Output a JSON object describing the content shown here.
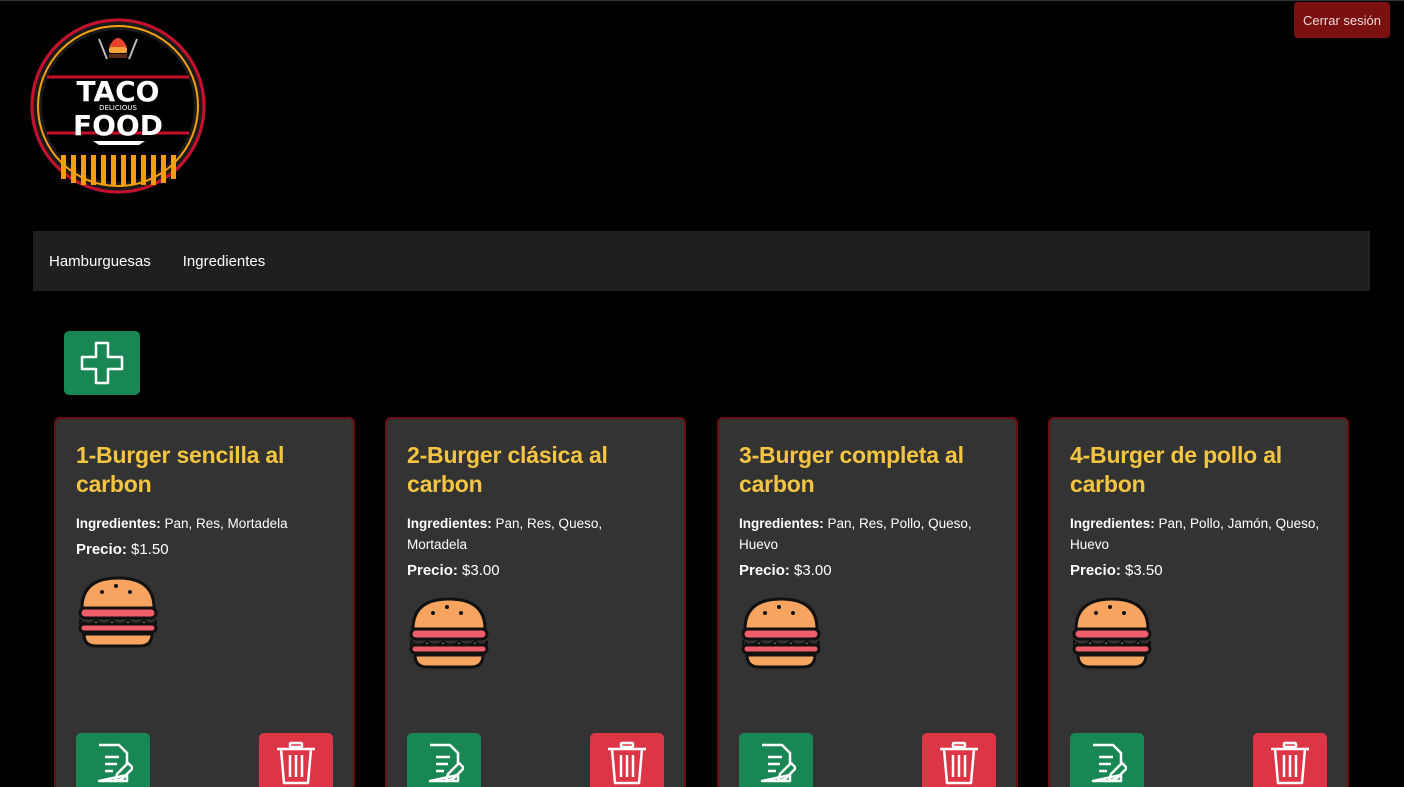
{
  "header": {
    "logout_label": "Cerrar sesión",
    "logo": {
      "line1": "TACO",
      "line2": "DELICIOUS",
      "line3": "FOOD"
    }
  },
  "nav": {
    "items": [
      {
        "label": "Hamburguesas"
      },
      {
        "label": "Ingredientes"
      }
    ]
  },
  "labels": {
    "ingredients": "Ingredientes:",
    "price": "Precio:"
  },
  "cards": [
    {
      "title": "1-Burger sencilla al carbon",
      "ingredients": "Pan, Res, Mortadela",
      "price": "$1.50"
    },
    {
      "title": "2-Burger clásica al carbon",
      "ingredients": "Pan, Res, Queso, Mortadela",
      "price": "$3.00"
    },
    {
      "title": "3-Burger completa al carbon",
      "ingredients": "Pan, Res, Pollo, Queso, Huevo",
      "price": "$3.00"
    },
    {
      "title": "4-Burger de pollo al carbon",
      "ingredients": "Pan, Pollo, Jamón, Queso, Huevo",
      "price": "$3.50"
    }
  ],
  "icons": {
    "add": "plus-icon",
    "edit": "edit-document-icon",
    "delete": "trash-icon",
    "burger": "burger-icon"
  },
  "colors": {
    "title": "#f5c542",
    "success": "#198754",
    "danger": "#dc3545",
    "logout": "#7a1010",
    "card_bg": "#333333",
    "card_border": "#6b0e0e"
  }
}
